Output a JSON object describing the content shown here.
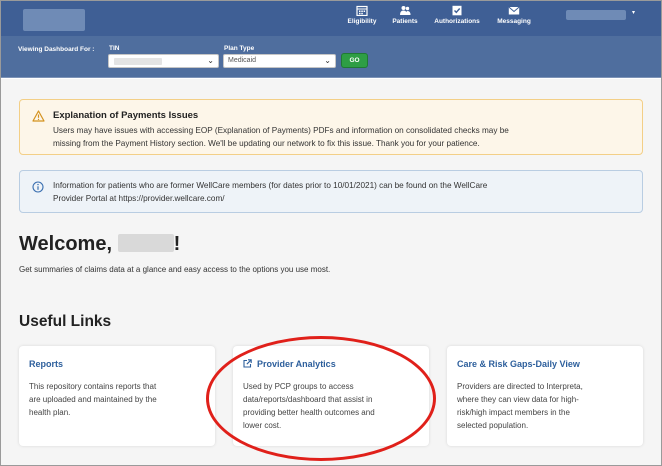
{
  "nav": {
    "items": [
      {
        "label": "Eligibility",
        "icon": "calendar-icon"
      },
      {
        "label": "Patients",
        "icon": "patients-icon"
      },
      {
        "label": "Authorizations",
        "icon": "authorizations-icon"
      },
      {
        "label": "Messaging",
        "icon": "envelope-icon"
      }
    ],
    "user_caret": "▾"
  },
  "filters": {
    "viewing_label": "Viewing Dashboard For :",
    "tin_label": "TIN",
    "plan_label": "Plan Type",
    "plan_value": "Medicaid",
    "go_label": "GO"
  },
  "alerts": {
    "warning": {
      "title": "Explanation of Payments Issues",
      "line1": "Users may have issues with accessing EOP (Explanation of Payments) PDFs and information on consolidated checks may be",
      "line2": "missing from the Payment History section. We'll be updating our network to fix this issue.  Thank you for your patience."
    },
    "info": {
      "line1": "Information for patients who are former WellCare members (for dates prior to 10/01/2021) can be found on the WellCare",
      "line2": "Provider Portal at https://provider.wellcare.com/"
    }
  },
  "welcome": {
    "prefix": "Welcome, ",
    "suffix": "!",
    "subtitle": "Get summaries of claims data at a glance and easy access to the options you use most."
  },
  "useful_links": {
    "heading": "Useful Links",
    "cards": [
      {
        "title": "Reports",
        "lines": [
          "This repository contains reports that",
          "are uploaded and maintained by the",
          "health plan."
        ]
      },
      {
        "title": "Provider Analytics",
        "icon": "external-link-icon",
        "lines": [
          "Used by PCP groups to access",
          "data/reports/dashboard that assist in",
          "providing better health outcomes and",
          "lower cost."
        ]
      },
      {
        "title": "Care & Risk Gaps-Daily View",
        "lines": [
          "Providers are directed to Interpreta,",
          "where they can view data for high-",
          "risk/high impact members in the",
          "selected population."
        ]
      }
    ]
  },
  "colors": {
    "header": "#3f5f95",
    "filterbar": "#4f6e9e",
    "go_button": "#2e9e45",
    "link_title": "#2d5f9c",
    "highlight": "#e0201a"
  }
}
